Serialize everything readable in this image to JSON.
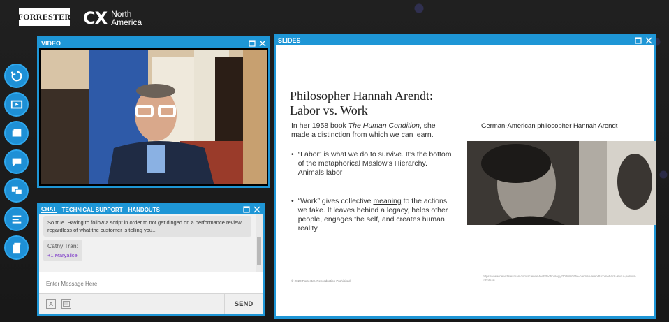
{
  "brand": {
    "forrester": "FORRESTER",
    "cx": "CX",
    "cx_sub1": "North",
    "cx_sub2": "America"
  },
  "rail": [
    {
      "icon": "refresh-icon"
    },
    {
      "icon": "video-icon"
    },
    {
      "icon": "slides-icon"
    },
    {
      "icon": "chat-icon"
    },
    {
      "icon": "support-icon"
    },
    {
      "icon": "agenda-icon"
    },
    {
      "icon": "handouts-icon"
    }
  ],
  "video": {
    "title": "VIDEO"
  },
  "slides": {
    "title": "SLIDES",
    "heading": "Philosopher Hannah Arendt: Labor vs. Work",
    "intro_pre": "In her 1958 book ",
    "intro_italic": "The Human Condition",
    "intro_post": ", she made a distinction from which we can learn.",
    "bullet1": "“Labor” is what we do to survive. It’s the bottom of the metaphorical Maslow’s Hierarchy. Animals labor",
    "bullet2_pre": "“Work” gives collective ",
    "bullet2_underline": "meaning",
    "bullet2_post": " to the actions we take. It leaves behind a legacy, helps other people, engages the self, and creates human reality.",
    "caption": "German-American philosopher Hannah Arendt",
    "footer_note": "© 2020 Forrester. Reproduction Prohibited.",
    "footer_url": "https://www.newstatesman.com/science-tech/technology/2020/03/the-hannah-arendt-comeback-about-politics-robots-ai"
  },
  "chat": {
    "tabs": [
      "CHAT",
      "TECHNICAL SUPPORT",
      "HANDOUTS"
    ],
    "message1": "So true. Having to follow a script in order to not get dinged on a performance review regardless of what the customer is telling you...",
    "message2_author": "Cathy Tran:",
    "message2_text": "+1 Maryalice",
    "input_placeholder": "Enter Message Here",
    "send_label": "SEND",
    "tool_font": "A"
  },
  "colors": {
    "accent": "#1e96d6",
    "background": "#1c1c1c",
    "mention": "#7b36c8"
  }
}
